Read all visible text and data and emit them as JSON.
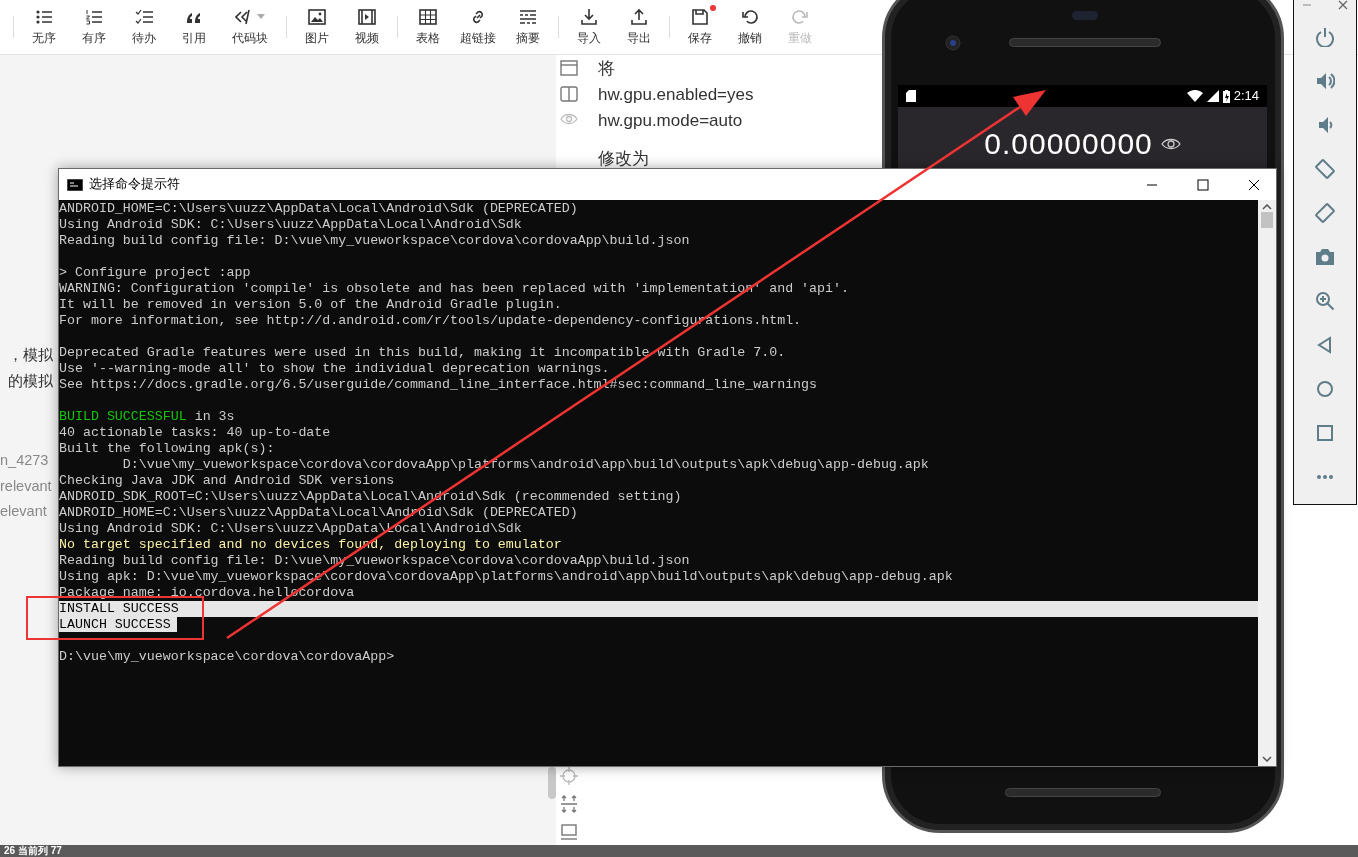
{
  "editor": {
    "toolbar": {
      "groups": [
        [
          {
            "label": "无序",
            "kind": "unordered",
            "disabled": false
          },
          {
            "label": "有序",
            "kind": "ordered",
            "disabled": false
          },
          {
            "label": "待办",
            "kind": "todo",
            "disabled": false
          },
          {
            "label": "引用",
            "kind": "quote",
            "disabled": false
          },
          {
            "label": "代码块",
            "kind": "code",
            "dropdown": true,
            "disabled": false
          }
        ],
        [
          {
            "label": "图片",
            "kind": "image",
            "disabled": false
          },
          {
            "label": "视频",
            "kind": "video",
            "disabled": false
          }
        ],
        [
          {
            "label": "表格",
            "kind": "table",
            "disabled": false
          },
          {
            "label": "超链接",
            "kind": "link",
            "disabled": false
          },
          {
            "label": "摘要",
            "kind": "summary",
            "disabled": false
          }
        ],
        [
          {
            "label": "导入",
            "kind": "import",
            "disabled": false
          },
          {
            "label": "导出",
            "kind": "export",
            "disabled": false
          }
        ],
        [
          {
            "label": "保存",
            "kind": "save",
            "modified": true,
            "disabled": false
          },
          {
            "label": "撤销",
            "kind": "undo",
            "disabled": false
          },
          {
            "label": "重做",
            "kind": "redo",
            "disabled": true
          }
        ]
      ]
    },
    "left_text_blocks": [
      {
        "kind": "body",
        "lines": [
          "，模拟",
          "的模拟"
        ]
      },
      {
        "kind": "muted",
        "lines": [
          "n_4273",
          "relevant",
          "elevant"
        ]
      }
    ],
    "preview_lines": [
      "将",
      "hw.gpu.enabled=yes",
      "hw.gpu.mode=auto",
      "修改为"
    ],
    "status_bar": "26  当前列 77"
  },
  "emulator": {
    "time": "2:14",
    "balance": "0.00000000"
  },
  "console_window": {
    "title": "选择命令提示符",
    "lines": [
      {
        "parts": [
          {
            "text": "ANDROID_HOME=C:\\Users\\uuzz\\AppData\\Local\\Android\\Sdk (DEPRECATED)",
            "kind": "normal"
          }
        ],
        "selected": false
      },
      {
        "parts": [
          {
            "text": "Using Android SDK: C:\\Users\\uuzz\\AppData\\Local\\Android\\Sdk",
            "kind": "normal"
          }
        ],
        "selected": false
      },
      {
        "parts": [
          {
            "text": "Reading build config file: D:\\vue\\my_vueworkspace\\cordova\\cordovaApp\\build.json",
            "kind": "normal"
          }
        ],
        "selected": false
      },
      {
        "selected": false
      },
      {
        "parts": [
          {
            "text": "> Configure project :app",
            "kind": "normal"
          }
        ],
        "selected": false
      },
      {
        "parts": [
          {
            "text": "WARNING: Configuration 'compile' is obsolete and has been replaced with 'implementation' and 'api'.",
            "kind": "normal"
          }
        ],
        "selected": false
      },
      {
        "parts": [
          {
            "text": "It will be removed in version 5.0 of the Android Gradle plugin.",
            "kind": "normal"
          }
        ],
        "selected": false
      },
      {
        "parts": [
          {
            "text": "For more information, see http://d.android.com/r/tools/update-dependency-configurations.html.",
            "kind": "normal"
          }
        ],
        "selected": false
      },
      {
        "selected": false
      },
      {
        "parts": [
          {
            "text": "Deprecated Gradle features were used in this build, making it incompatible with Gradle 7.0.",
            "kind": "normal"
          }
        ],
        "selected": false
      },
      {
        "parts": [
          {
            "text": "Use '--warning-mode all' to show the individual deprecation warnings.",
            "kind": "normal"
          }
        ],
        "selected": false
      },
      {
        "parts": [
          {
            "text": "See https://docs.gradle.org/6.5/userguide/command_line_interface.html#sec:command_line_warnings",
            "kind": "normal"
          }
        ],
        "selected": false
      },
      {
        "selected": false
      },
      {
        "parts": [
          {
            "text": "BUILD SUCCESSFUL",
            "kind": "success"
          },
          {
            "text": " in 3s",
            "kind": "normal"
          }
        ],
        "selected": false
      },
      {
        "parts": [
          {
            "text": "40 actionable tasks: 40 up-to-date",
            "kind": "normal"
          }
        ],
        "selected": false
      },
      {
        "parts": [
          {
            "text": "Built the following apk(s):",
            "kind": "normal"
          }
        ],
        "selected": false
      },
      {
        "parts": [
          {
            "text": "        D:\\vue\\my_vueworkspace\\cordova\\cordovaApp\\platforms\\android\\app\\build\\outputs\\apk\\debug\\app-debug.apk",
            "kind": "normal"
          }
        ],
        "selected": false
      },
      {
        "parts": [
          {
            "text": "Checking Java JDK and Android SDK versions",
            "kind": "normal"
          }
        ],
        "selected": false
      },
      {
        "parts": [
          {
            "text": "ANDROID_SDK_ROOT=C:\\Users\\uuzz\\AppData\\Local\\Android\\Sdk (recommended setting)",
            "kind": "normal"
          }
        ],
        "selected": false
      },
      {
        "parts": [
          {
            "text": "ANDROID_HOME=C:\\Users\\uuzz\\AppData\\Local\\Android\\Sdk (DEPRECATED)",
            "kind": "normal"
          }
        ],
        "selected": false
      },
      {
        "parts": [
          {
            "text": "Using Android SDK: C:\\Users\\uuzz\\AppData\\Local\\Android\\Sdk",
            "kind": "normal"
          }
        ],
        "selected": false
      },
      {
        "parts": [
          {
            "text": "No target specified and no devices found, deploying to emulator",
            "kind": "warning"
          }
        ],
        "selected": false
      },
      {
        "parts": [
          {
            "text": "Reading build config file: D:\\vue\\my_vueworkspace\\cordova\\cordovaApp\\build.json",
            "kind": "normal"
          }
        ],
        "selected": false
      },
      {
        "parts": [
          {
            "text": "Using apk: D:\\vue\\my_vueworkspace\\cordova\\cordovaApp\\platforms\\android\\app\\build\\outputs\\apk\\debug\\app-debug.apk",
            "kind": "normal"
          }
        ],
        "selected": false
      },
      {
        "parts": [
          {
            "text": "Package name: io.cordova.hellocordova",
            "kind": "normal"
          }
        ],
        "selected": false
      },
      {
        "parts": [
          {
            "text": "INSTALL SUCCESS",
            "kind": "normal"
          }
        ],
        "selected": true
      },
      {
        "parts": [
          {
            "text": "LAUNCH SUCCESS",
            "kind": "normal"
          }
        ],
        "selected": true
      },
      {
        "selected": false
      },
      {
        "parts": [
          {
            "text": "D:\\vue\\my_vueworkspace\\cordova\\cordovaApp>",
            "kind": "normal"
          }
        ],
        "selected": false
      }
    ]
  }
}
